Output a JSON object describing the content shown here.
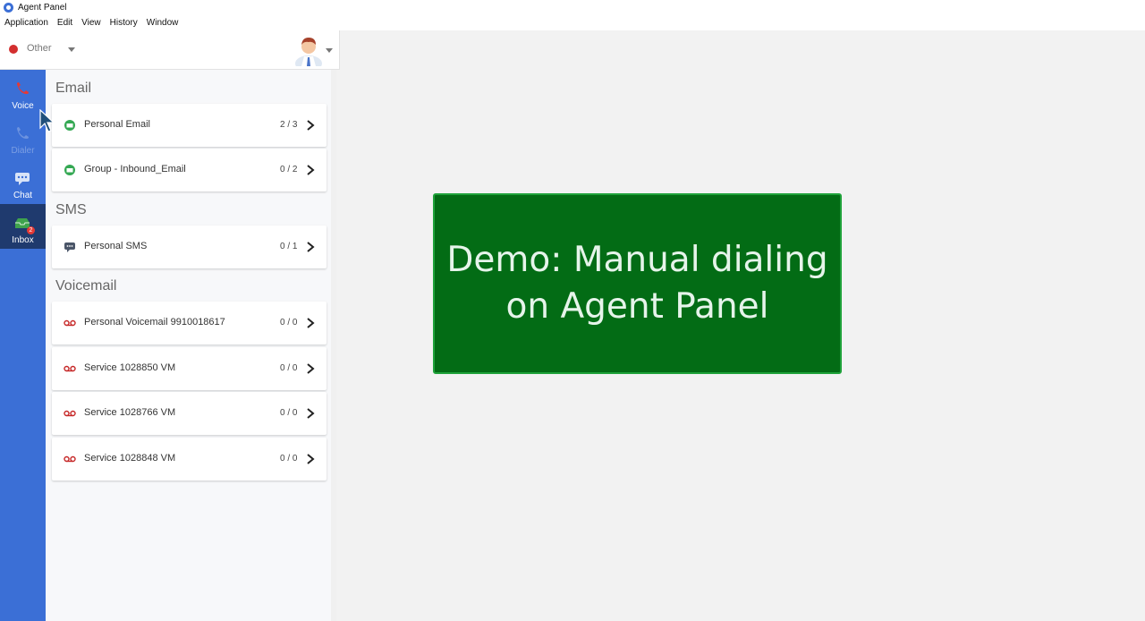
{
  "window": {
    "title": "Agent Panel"
  },
  "menubar": [
    "Application",
    "Edit",
    "View",
    "History",
    "Window"
  ],
  "status": {
    "label": "Other",
    "dot_color": "#d32f2f"
  },
  "nav": [
    {
      "label": "Voice",
      "icon": "phone-icon",
      "state": "normal"
    },
    {
      "label": "Dialer",
      "icon": "dialer-icon",
      "state": "disabled"
    },
    {
      "label": "Chat",
      "icon": "chat-icon",
      "state": "normal"
    },
    {
      "label": "Inbox",
      "icon": "inbox-icon",
      "state": "active",
      "badge": "2"
    }
  ],
  "sections": [
    {
      "title": "Email",
      "items": [
        {
          "label": "Personal Email",
          "count": "2 / 3",
          "icon": "email-icon"
        },
        {
          "label": "Group - Inbound_Email",
          "count": "0 / 2",
          "icon": "email-icon"
        }
      ]
    },
    {
      "title": "SMS",
      "items": [
        {
          "label": "Personal SMS",
          "count": "0 / 1",
          "icon": "sms-icon"
        }
      ]
    },
    {
      "title": "Voicemail",
      "items": [
        {
          "label": "Personal Voicemail 9910018617",
          "count": "0 / 0",
          "icon": "voicemail-icon"
        },
        {
          "label": "Service 1028850 VM",
          "count": "0 / 0",
          "icon": "voicemail-icon"
        },
        {
          "label": "Service 1028766 VM",
          "count": "0 / 0",
          "icon": "voicemail-icon"
        },
        {
          "label": "Service 1028848 VM",
          "count": "0 / 0",
          "icon": "voicemail-icon"
        }
      ]
    }
  ],
  "banner": {
    "line1": "Demo: Manual dialing",
    "line2": "on Agent Panel",
    "bg_color": "#036c15"
  }
}
